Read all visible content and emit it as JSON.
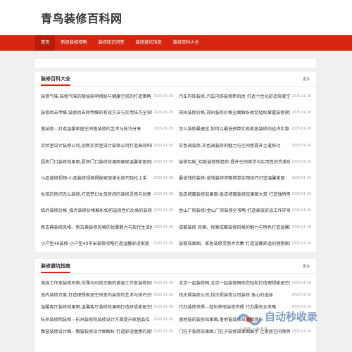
{
  "site": {
    "title": "青鸟装修百科网"
  },
  "nav": {
    "items": [
      "首页",
      "新居装修攻略",
      "装修知识问答",
      "装修避坑指南",
      "装修百科大全"
    ],
    "active_index": 0
  },
  "section1": {
    "title": "装修百科大全",
    "more": "更多",
    "left": [
      {
        "title": "装修气味,装修气味的隐秘影响揭秘与健康空间的打造策略",
        "date": "2025-01-30"
      },
      {
        "title": "装修后去甲醛,装修后去除甲醛的有效方法与实用技巧全攻略",
        "date": "2025-01-30"
      },
      {
        "title": "蓬装修—打造温馨家居空间蓬装修的艺术与技巧分享",
        "date": "2025-01-30"
      },
      {
        "title": "实验室设计装修公司,创新实验室设计装修公司打造高效科研空间",
        "date": "2025-01-30"
      },
      {
        "title": "厨房门口装修效果图,厨房门口装修效果图展现温馨家居风格",
        "date": "2025-01-30"
      },
      {
        "title": "小品装修视频-小品装修视频揭秘家居美化技巧轻松上手",
        "date": "2025-01-30"
      },
      {
        "title": "女孩的房间怎么装修,打造梦幻女孩房间的装修灵感与创意",
        "date": "2025-01-30"
      },
      {
        "title": "临沂装修价格_临沂装修价格解析如何选择性价比高的装修方案",
        "date": "2025-01-30"
      },
      {
        "title": "新古典装修风格、新古典装修风格的优雅魅力与现代生活的完美融合",
        "date": "2025-01-30"
      },
      {
        "title": "小户型40装修-小户型40平米装修攻略打造温馨舒适家居",
        "date": "2025-01-30"
      }
    ],
    "right": [
      {
        "title": "汽车内饰装修,汽车内饰装修新风尚 打造个性化舒适驾驶空间",
        "date": "2025-01-30"
      },
      {
        "title": "郑州装修价格,郑州装修价格全面解析助您轻松掌握装修预算",
        "date": "2025-01-30"
      },
      {
        "title": "怎么装修最便宜,如何以最低预算实现家居装修的经济实惠",
        "date": "2025-01-30"
      },
      {
        "title": "灰色调装修,灰色调装修的魅力与空间感提升之道探讨",
        "date": "2025-01-30"
      },
      {
        "title": "装修铝板_铝板装修新趋势:提升空间美学与实用性的完美结合",
        "date": "2025-01-30"
      },
      {
        "title": "最省钱的装修-省钱装修攻略简单实用技巧打造温馨家居",
        "date": "2025-01-30"
      },
      {
        "title": "饭店墙面装修效果图-饭店墙面装修效果图大赏 打造独特用餐氛围",
        "date": "2025-01-30"
      },
      {
        "title": "金山厂房装修(金山厂房装修全攻略 打造高效舒适工作环境)",
        "date": "2025-01-30"
      },
      {
        "title": "成都装修 风格、探索成都装修风格的魅力与特色打造温馨家居",
        "date": "2025-01-30"
      },
      {
        "title": "装修效果图、家居装修灵感大合集 打造温馨舒适的理想家居",
        "date": "2025-01-30"
      }
    ]
  },
  "section2": {
    "title": "装修避坑指南",
    "more": "更多",
    "left": [
      {
        "title": "美容工作室装修风格,优雅与时尚交融的美容工作室装修风格解析",
        "date": "2025-01-30"
      },
      {
        "title": "室内装修方案,打造理想家居空间室内装修的艺术与技巧分享",
        "date": "2025-01-30"
      },
      {
        "title": "温馨客厅装修效果图,温馨客厅装修效果图打造舒适家居空间",
        "date": "2025-01-30"
      },
      {
        "title": "杭州装修院装修—杭州装修院装修设计方案提升家居品位",
        "date": "2025-01-30"
      },
      {
        "title": "飘窗装修设计图—飘窗装修设计图解析 打造舒适惬意的阅读空间",
        "date": "2025-01-30"
      }
    ],
    "right": [
      {
        "title": "北京一起装修网,北京一起装修网助您轻松打造理想家居空间",
        "date": "2025-01-30"
      },
      {
        "title": "找正规装修公司,找正规装修公司装修 放心的选择",
        "date": "2025-01-30"
      },
      {
        "title": "代办装修资质—轻松获取装修资质 代办服务全攻略",
        "date": "2025-01-30"
      },
      {
        "title": "落地窗的装修效果图,落地窗装修效果图赏析",
        "date": "2025-01-30"
      },
      {
        "title": "门柱子装修效果图,门柱子装修效果图展示 让家居空间焕然一新",
        "date": "2025-01-30"
      }
    ]
  },
  "watermark": {
    "text": "自动秒收录",
    "sub": "让链接·一秒收录"
  }
}
